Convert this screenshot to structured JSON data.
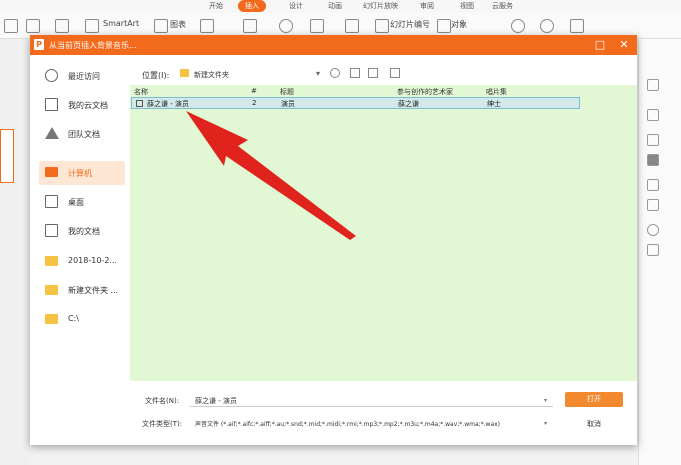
{
  "ribbon": {
    "tabs": [
      "开始",
      "插入",
      "设计",
      "动画",
      "幻灯片放映",
      "审阅",
      "视图",
      "云服务"
    ],
    "active_tab": "插入",
    "tools": [
      "SmartArt",
      "图表",
      "幻灯片编号",
      "对象"
    ]
  },
  "dialog": {
    "logo": "P",
    "title": "从当前页插入背景音乐...",
    "places": [
      {
        "label": "最近访问",
        "icon": "clock-icon"
      },
      {
        "label": "我的云文档",
        "icon": "cloud-cube-icon"
      },
      {
        "label": "团队文档",
        "icon": "team-icon"
      },
      {
        "label": "计算机",
        "icon": "computer-icon",
        "selected": true
      },
      {
        "label": "桌面",
        "icon": "desktop-icon"
      },
      {
        "label": "我的文档",
        "icon": "documents-icon"
      },
      {
        "label": "2018-10-2...",
        "icon": "folder-icon"
      },
      {
        "label": "新建文件夹 ...",
        "icon": "folder-icon"
      },
      {
        "label": "C:\\",
        "icon": "folder-icon"
      }
    ],
    "location_label": "位置(I):",
    "location_value": "新建文件夹",
    "columns": [
      "名称",
      "#",
      "标题",
      "参与创作的艺术家",
      "唱片集"
    ],
    "rows": [
      {
        "name": "薛之谦 - 演员",
        "number": "2",
        "title": "演员",
        "artist": "薛之谦",
        "album": "绅士"
      }
    ],
    "filename_label": "文件名(N):",
    "filename_value": "薛之谦 - 演员",
    "filetype_label": "文件类型(T):",
    "filetype_value": "声音文件 (*.aif;*.aifc;*.aiff;*.au;*.snd;*.mid;*.midi;*.rmi;*.mp3;*.mp2;*.m3u;*.m4a;*.wav;*.wma;*.wax)",
    "open_label": "打开",
    "cancel_label": "取消"
  },
  "colors": {
    "accent": "#f26a1b",
    "file_area": "#e2f7d3",
    "arrow": "#e0231c"
  }
}
